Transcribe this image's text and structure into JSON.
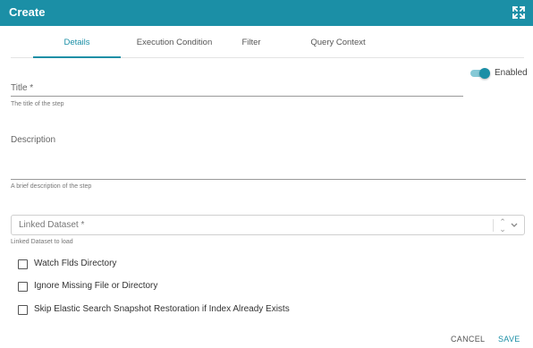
{
  "dialog": {
    "title": "Create"
  },
  "tabs": [
    {
      "label": "Details",
      "active": true
    },
    {
      "label": "Execution Condition",
      "active": false
    },
    {
      "label": "Filter",
      "active": false
    },
    {
      "label": "Query Context",
      "active": false
    }
  ],
  "toggle": {
    "label": "Enabled",
    "on": true
  },
  "fields": {
    "title": {
      "label": "Title *",
      "value": "",
      "helper": "The title of the step"
    },
    "description": {
      "label": "Description",
      "value": "",
      "helper": "A brief description of the step"
    },
    "linked_dataset": {
      "placeholder": "Linked Dataset *",
      "helper": "Linked Dataset to load"
    }
  },
  "checkboxes": [
    {
      "label": "Watch Flds Directory",
      "checked": false
    },
    {
      "label": "Ignore Missing File or Directory",
      "checked": false
    },
    {
      "label": "Skip Elastic Search Snapshot Restoration if Index Already Exists",
      "checked": false
    }
  ],
  "actions": {
    "cancel": "CANCEL",
    "save": "SAVE"
  },
  "colors": {
    "accent": "#1b8fa6",
    "header_bg": "#1b8fa6"
  }
}
